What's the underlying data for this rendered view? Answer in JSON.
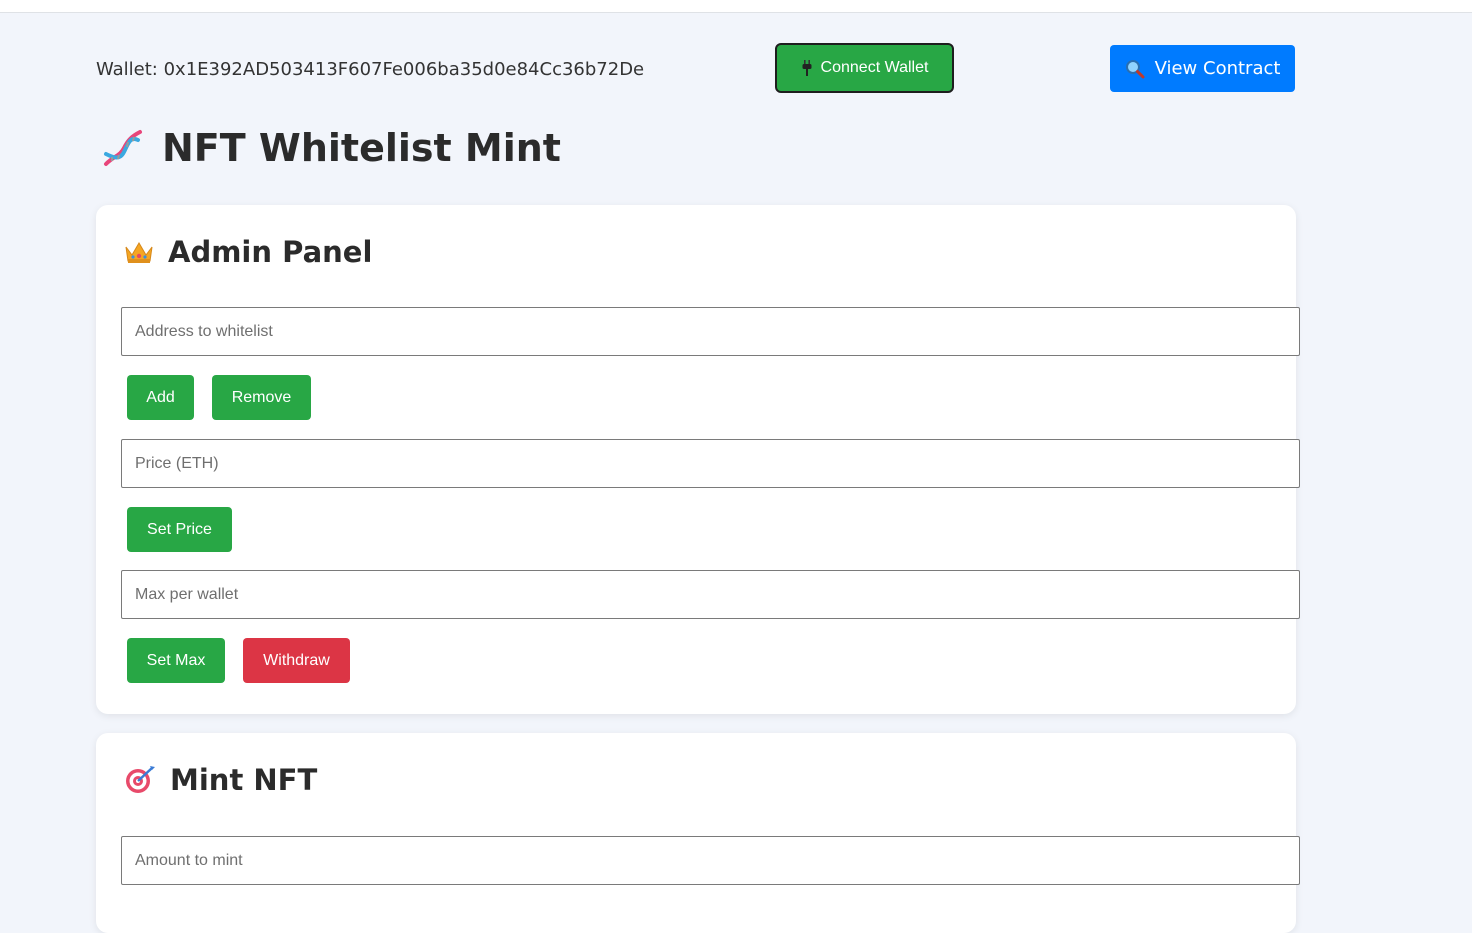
{
  "header": {
    "wallet_label": "Wallet: 0x1E392AD503413F607Fe006ba35d0e84Cc36b72De",
    "connect_label": "Connect Wallet",
    "connect_icon": "plug-icon",
    "contract_label": "View Contract",
    "contract_icon": "magnifier-icon"
  },
  "page": {
    "title": "NFT Whitelist Mint",
    "title_icon": "dna-icon"
  },
  "admin_panel": {
    "title": "Admin Panel",
    "title_icon": "crown-icon",
    "address_placeholder": "Address to whitelist",
    "add_label": "Add",
    "remove_label": "Remove",
    "price_placeholder": "Price (ETH)",
    "set_price_label": "Set Price",
    "max_placeholder": "Max per wallet",
    "set_max_label": "Set Max",
    "withdraw_label": "Withdraw"
  },
  "mint_panel": {
    "title": "Mint NFT",
    "title_icon": "target-icon",
    "amount_placeholder": "Amount to mint"
  },
  "colors": {
    "background": "#f2f5fb",
    "green": "#28a745",
    "blue": "#007bff",
    "red": "#dc3545"
  }
}
